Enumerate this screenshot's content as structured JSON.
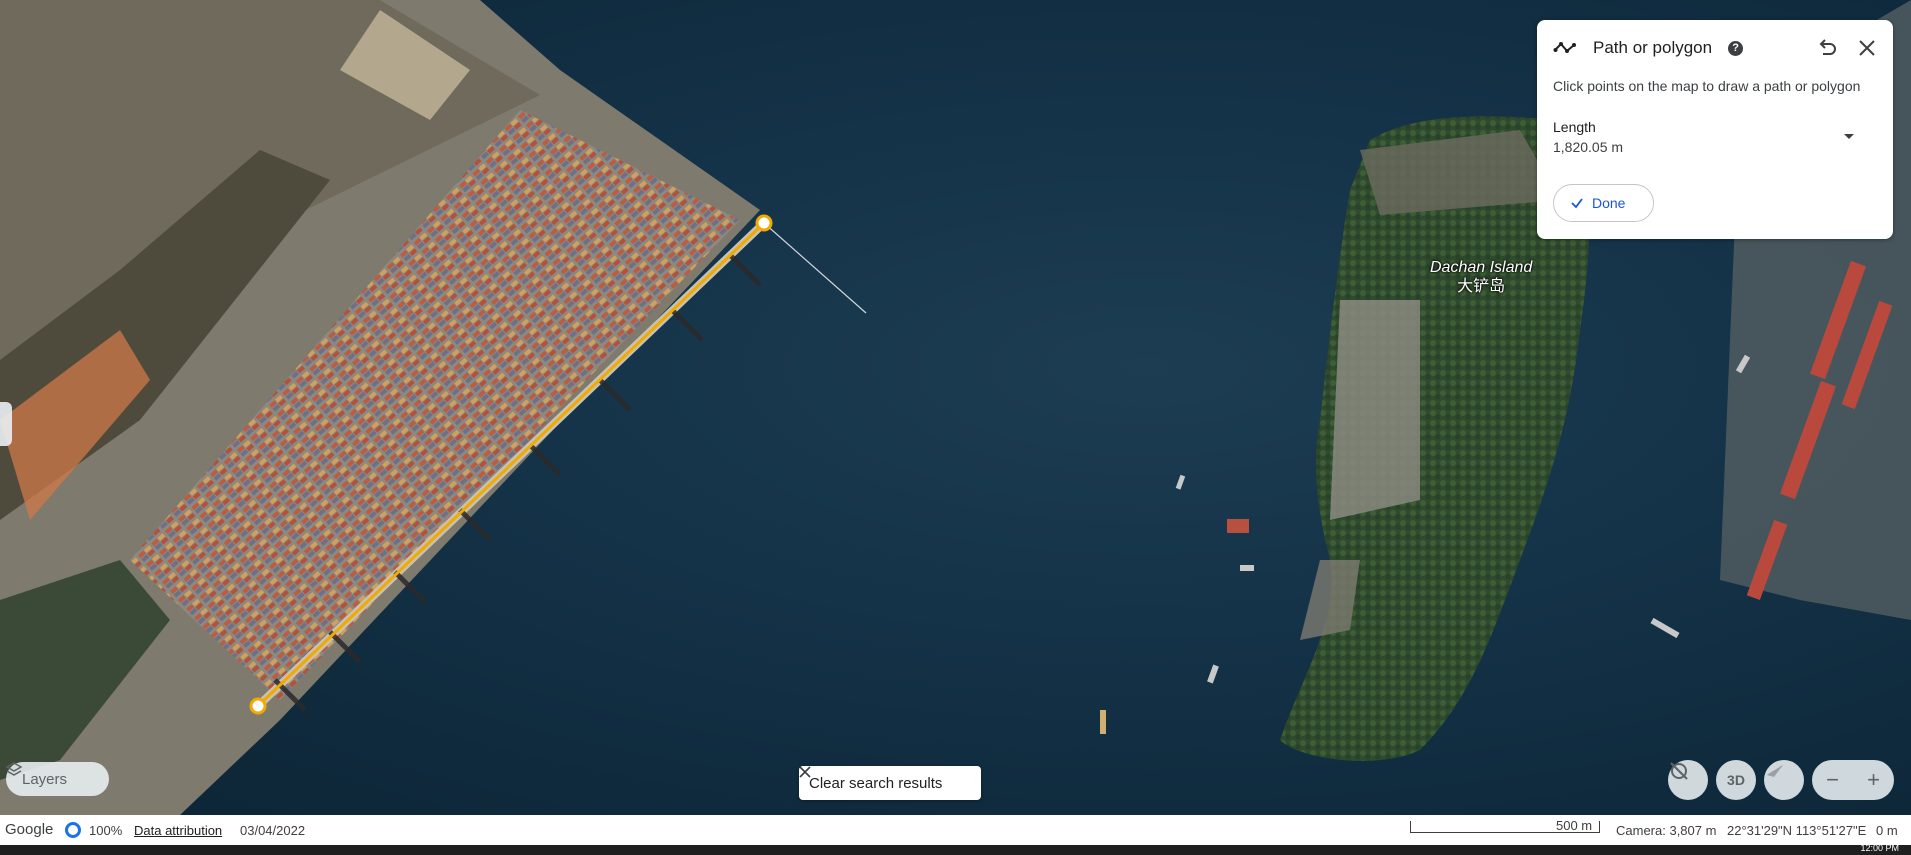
{
  "map": {
    "place_label_en": "Dachan Island",
    "place_label_zh": "大铲岛",
    "colors": {
      "measure_line": "#f2a900",
      "water": "#15344a"
    }
  },
  "measure_panel": {
    "title": "Path or polygon",
    "help_icon": "help-icon",
    "hint": "Click points on the map to draw a path or polygon",
    "length_label": "Length",
    "length_value": "1,820.05 m",
    "done_label": "Done"
  },
  "controls": {
    "layers_label": "Layers",
    "clear_search_label": "Clear search results",
    "three_d_label": "3D",
    "zoom_out": "−",
    "zoom_in": "+"
  },
  "status_bar": {
    "brand": "Google",
    "percent": "100%",
    "attribution": "Data attribution",
    "date": "03/04/2022",
    "scale": "500 m",
    "camera": "Camera: 3,807 m",
    "coords": "22°31'29\"N 113°51'27\"E",
    "elevation": "0 m"
  },
  "taskbar": {
    "clock": "12:00 PM"
  }
}
